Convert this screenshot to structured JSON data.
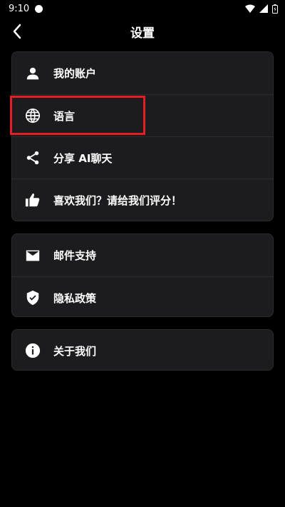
{
  "status_bar": {
    "time": "9:10",
    "battery_glyph": "battery-icon",
    "signal_glyph": "signal-icon",
    "wifi_glyph": "wifi-icon"
  },
  "header": {
    "title": "设置",
    "back_icon": "chevron-left-icon"
  },
  "groups": [
    {
      "items": [
        {
          "label": "我的账户",
          "icon": "person-icon"
        },
        {
          "label": "语言",
          "icon": "globe-icon"
        },
        {
          "label": "分享 AI聊天",
          "icon": "share-icon"
        },
        {
          "label": "喜欢我们？请给我们评分！",
          "icon": "thumbs-up-icon"
        }
      ]
    },
    {
      "items": [
        {
          "label": "邮件支持",
          "icon": "mail-icon"
        },
        {
          "label": "隐私政策",
          "icon": "shield-check-icon"
        }
      ]
    },
    {
      "items": [
        {
          "label": "关于我们",
          "icon": "info-icon"
        }
      ]
    }
  ],
  "colors": {
    "background": "#000000",
    "card": "#1c1c1e",
    "divider": "#2c2c2e",
    "text": "#ffffff",
    "highlight": "#e31e24"
  }
}
